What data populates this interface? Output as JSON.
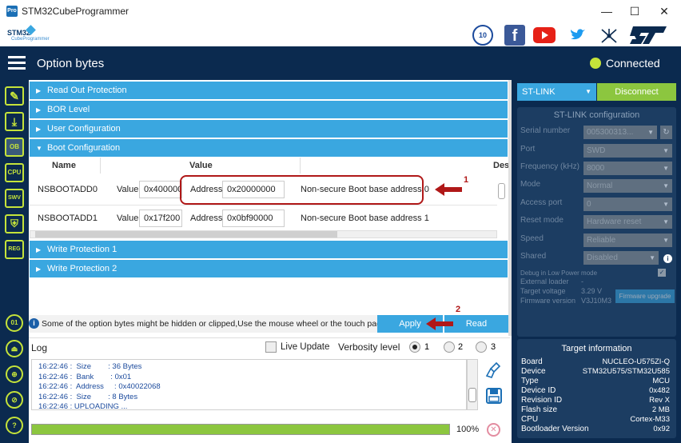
{
  "window": {
    "title": "STM32CubeProgrammer",
    "min": "—",
    "max": "☐",
    "close": "✕",
    "app_icon": "Pro"
  },
  "brand": {
    "logo_line1": "STM32",
    "logo_line2": "CubeProgrammer",
    "badge_icon": "10-anniversary-badge-icon",
    "facebook": "f",
    "st": "ST"
  },
  "header": {
    "title": "Option bytes",
    "status": "Connected",
    "status_color": "#c5e33a"
  },
  "nav": {
    "icons": [
      "edit-icon",
      "download-icon",
      "ob-icon",
      "cpu-icon",
      "swv-icon",
      "shield-icon",
      "reg-icon"
    ],
    "ob": "OB",
    "cpu": "CPU",
    "swv": "SWV",
    "reg": "REG",
    "bottom": [
      "01",
      "⏏",
      "⊕",
      "⊘",
      "?"
    ]
  },
  "sections": {
    "read_out": "Read Out Protection",
    "bor": "BOR Level",
    "user": "User Configuration",
    "boot": "Boot Configuration",
    "write1": "Write Protection 1",
    "write2": "Write Protection 2"
  },
  "table": {
    "headers": {
      "name": "Name",
      "value": "Value",
      "desc": "Des"
    },
    "rows": [
      {
        "name": "NSBOOTADD0",
        "value_label": "Value",
        "value": "0x400000",
        "addr_label": "Address",
        "addr": "0x20000000",
        "desc": "Non-secure Boot base address 0"
      },
      {
        "name": "NSBOOTADD1",
        "value_label": "Value",
        "value": "0x17f200",
        "addr_label": "Address",
        "addr": "0x0bf90000",
        "desc": "Non-secure Boot base address 1"
      }
    ]
  },
  "annotations": {
    "n1": "1",
    "n2": "2"
  },
  "info": {
    "text": "Some of the option bytes might be hidden or clipped,Use the mouse wheel or the touch pad to scro",
    "icon": "i"
  },
  "buttons": {
    "apply": "Apply",
    "read": "Read"
  },
  "log": {
    "title": "Log",
    "live_update": "Live Update",
    "verbosity": "Verbosity level",
    "levels": [
      "1",
      "2",
      "3"
    ],
    "lines": [
      "16:22:46 :  Size        : 36 Bytes",
      "16:22:46 :  Bank        : 0x01",
      "16:22:46 :  Address     : 0x40022068",
      "16:22:46 :  Size        : 8 Bytes",
      "16:22:46 : UPLOADING ..."
    ],
    "progress": 1.0,
    "progress_text": "100%"
  },
  "right": {
    "interface": "ST-LINK",
    "disconnect": "Disconnect",
    "config_title": "ST-LINK configuration",
    "fields": [
      {
        "label": "Serial number",
        "value": "005300313..."
      },
      {
        "label": "Port",
        "value": "SWD"
      },
      {
        "label": "Frequency (kHz)",
        "value": "8000"
      },
      {
        "label": "Mode",
        "value": "Normal"
      },
      {
        "label": "Access port",
        "value": "0"
      },
      {
        "label": "Reset mode",
        "value": "Hardware reset"
      },
      {
        "label": "Speed",
        "value": "Reliable"
      },
      {
        "label": "Shared",
        "value": "Disabled"
      }
    ],
    "debug_low_power": "Debug in Low Power mode",
    "external_loader": "External loader",
    "external_loader_val": "-",
    "target_voltage": "Target voltage",
    "target_voltage_val": "3.29 V",
    "firmware_version": "Firmware version",
    "firmware_version_val": "V3J10M3",
    "firmware_upgrade": "Firmware upgrade",
    "target_title": "Target information",
    "target": [
      {
        "label": "Board",
        "value": "NUCLEO-U575ZI-Q"
      },
      {
        "label": "Device",
        "value": "STM32U575/STM32U585"
      },
      {
        "label": "Type",
        "value": "MCU"
      },
      {
        "label": "Device ID",
        "value": "0x482"
      },
      {
        "label": "Revision ID",
        "value": "Rev X"
      },
      {
        "label": "Flash size",
        "value": "2 MB"
      },
      {
        "label": "CPU",
        "value": "Cortex-M33"
      },
      {
        "label": "Bootloader Version",
        "value": "0x92"
      }
    ]
  }
}
